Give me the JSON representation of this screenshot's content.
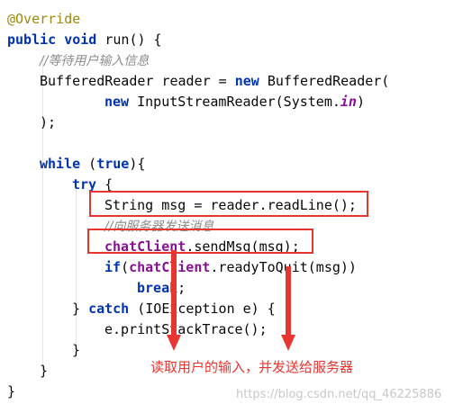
{
  "code": {
    "l1": "@Override",
    "l2_kw1": "public",
    "l2_kw2": "void",
    "l2_rest": " run() {",
    "l3_comment": "//等待用户输入信息",
    "l4_a": "BufferedReader reader = ",
    "l4_kw": "new",
    "l4_b": " BufferedReader(",
    "l5_kw": "new",
    "l5_a": " InputStreamReader(System.",
    "l5_field": "in",
    "l5_b": ")",
    "l6": ");",
    "l8_kw1": "while",
    "l8_a": " (",
    "l8_kw2": "true",
    "l8_b": "){",
    "l9_kw": "try",
    "l9_rest": " {",
    "l10": "String msg = reader.readLine();",
    "l11_comment": "//向服务器发送消息",
    "l12_var": "chatClient",
    "l12_rest": ".sendMsg(msg);",
    "l13_kw": "if",
    "l13_a": "(",
    "l13_var": "chatClient",
    "l13_b": ".readyToQuit(msg))",
    "l14_kw": "break",
    "l14_rest": ";",
    "l15_a": "} ",
    "l15_kw": "catch",
    "l15_b": " (IOException e) {",
    "l16": "e.printStackTrace();",
    "l17": "}",
    "l18": "}",
    "l19": "}"
  },
  "annotation": {
    "text": "读取用户的输入，并发送给服务器",
    "color": "#e8352f"
  },
  "watermark": "https://blog.csdn.net/qq_46225886"
}
